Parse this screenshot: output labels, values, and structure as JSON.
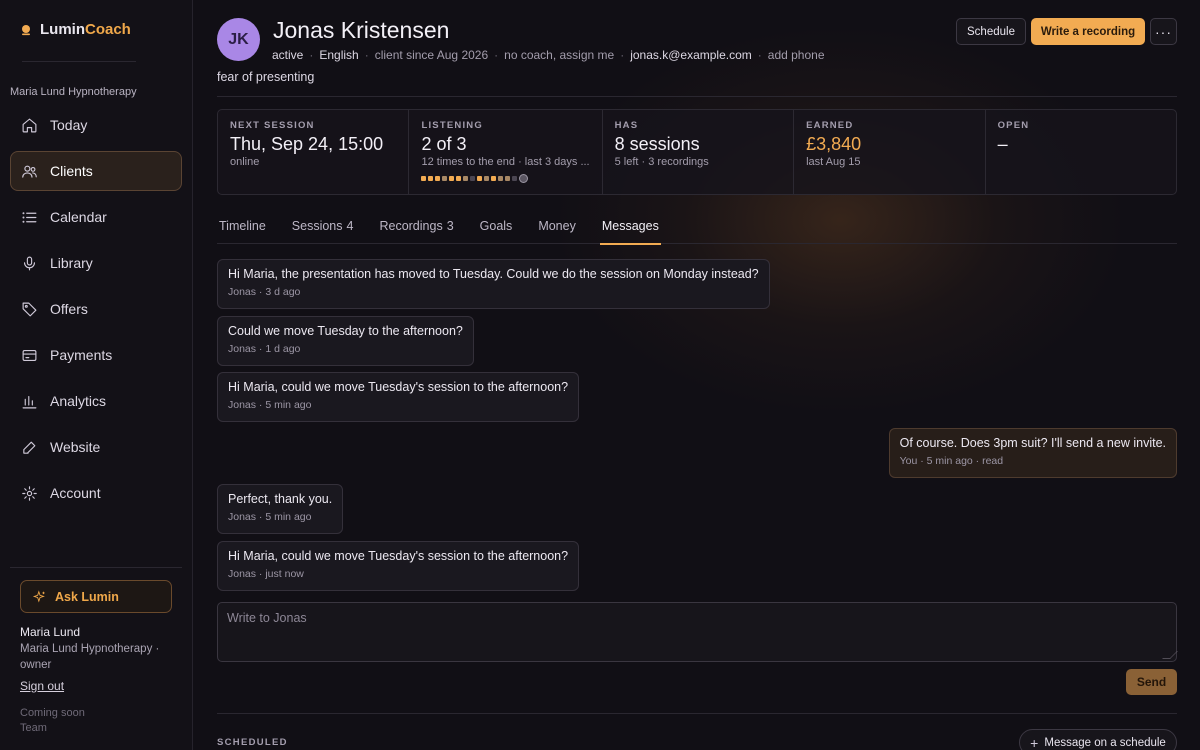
{
  "brand": {
    "part1": "Lumin",
    "part2": "Coach"
  },
  "org_name": "Maria Lund Hypnotherapy",
  "nav": [
    {
      "label": "Today",
      "icon": "home-icon"
    },
    {
      "label": "Clients",
      "icon": "users-icon",
      "active": true
    },
    {
      "label": "Calendar",
      "icon": "list-icon"
    },
    {
      "label": "Library",
      "icon": "microphone-icon"
    },
    {
      "label": "Offers",
      "icon": "tag-icon"
    },
    {
      "label": "Payments",
      "icon": "card-icon"
    },
    {
      "label": "Analytics",
      "icon": "bar-chart-icon"
    },
    {
      "label": "Website",
      "icon": "edit-icon"
    },
    {
      "label": "Account",
      "icon": "gear-icon"
    }
  ],
  "ask": {
    "label": "Ask Lumin"
  },
  "user": {
    "name": "Maria Lund",
    "org_role": "Maria Lund Hypnotherapy · owner",
    "sign_out": "Sign out"
  },
  "coming_soon": {
    "label": "Coming soon",
    "item": "Team"
  },
  "client": {
    "initials": "JK",
    "name": "Jonas Kristensen",
    "status": "active",
    "language": "English",
    "since": "client since Aug 2026",
    "coach": "no coach, assign me",
    "email": "jonas.k@example.com",
    "phone": "add phone",
    "concern": "fear of presenting"
  },
  "actions": {
    "schedule": "Schedule",
    "write": "Write a recording",
    "more": "···"
  },
  "stats": {
    "next": {
      "label": "NEXT SESSION",
      "value": "Thu, Sep 24, 15:00",
      "sub": "online"
    },
    "listening": {
      "label": "LISTENING",
      "value": "2 of 3",
      "sub": "12 times to the end · last 3 days ...",
      "progress": [
        "on",
        "on",
        "on",
        "mid",
        "on",
        "on",
        "mid",
        "off",
        "on",
        "mid",
        "on",
        "mid",
        "mid",
        "off"
      ]
    },
    "has": {
      "label": "HAS",
      "value": "8 sessions",
      "sub": "5 left · 3 recordings"
    },
    "earned": {
      "label": "EARNED",
      "value": "£3,840",
      "sub": "last Aug 15"
    },
    "open": {
      "label": "OPEN",
      "value": "–"
    }
  },
  "tabs": [
    {
      "label": "Timeline",
      "count": ""
    },
    {
      "label": "Sessions",
      "count": "4"
    },
    {
      "label": "Recordings",
      "count": "3"
    },
    {
      "label": "Goals",
      "count": ""
    },
    {
      "label": "Money",
      "count": ""
    },
    {
      "label": "Messages",
      "count": "",
      "active": true
    }
  ],
  "messages": [
    {
      "text": "Hi Maria, the presentation has moved to Tuesday. Could we do the session on Monday instead?",
      "meta": "Jonas · 3 d ago"
    },
    {
      "text": "Could we move Tuesday to the afternoon?",
      "meta": "Jonas · 1 d ago"
    },
    {
      "text": "Hi Maria, could we move Tuesday's session to the afternoon?",
      "meta": "Jonas · 5 min ago"
    },
    {
      "text": "Of course. Does 3pm suit? I'll send a new invite.",
      "meta": "You · 5 min ago · read"
    },
    {
      "text": "Perfect, thank you.",
      "meta": "Jonas · 5 min ago"
    },
    {
      "text": "Hi Maria, could we move Tuesday's session to the afternoon?",
      "meta": "Jonas · just now"
    }
  ],
  "compose": {
    "placeholder": "Write to Jonas",
    "send": "Send"
  },
  "scheduled": {
    "label": "SCHEDULED",
    "button": "Message on a schedule"
  },
  "colors": {
    "accent": "#f2ab52",
    "avatar": "#a987e6",
    "background": "#110f15"
  }
}
